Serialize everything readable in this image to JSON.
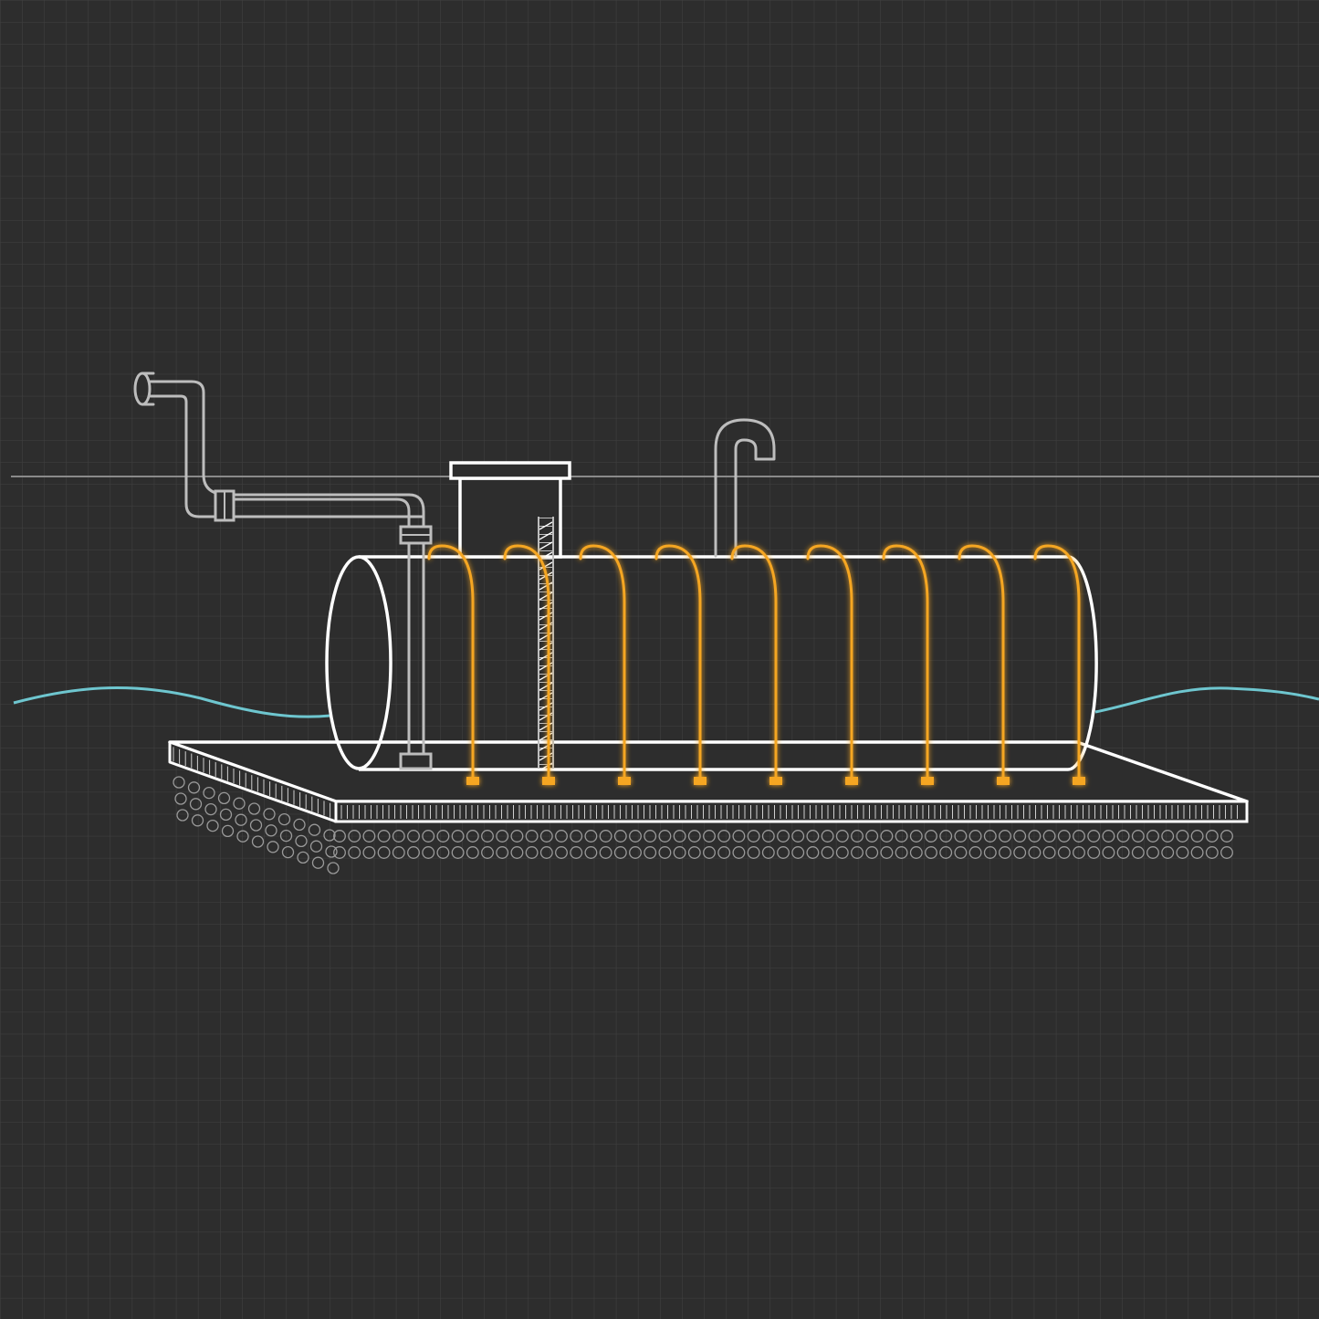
{
  "scene": {
    "subject": "underground-tank-with-hold-down-straps",
    "colors": {
      "background": "#2d2d2d",
      "grid": "#414141",
      "outline": "#ffffff",
      "pipe": "#bdbdbd",
      "strap": "#f5a623",
      "water": "#6ec6cf",
      "ground_line": "#8a8a8a",
      "gravel": "#9a9a9a"
    },
    "strap_count": 9,
    "icons": [
      "fill-pipe-icon",
      "vent-pipe-icon",
      "manway-icon",
      "anchor-icon"
    ]
  }
}
